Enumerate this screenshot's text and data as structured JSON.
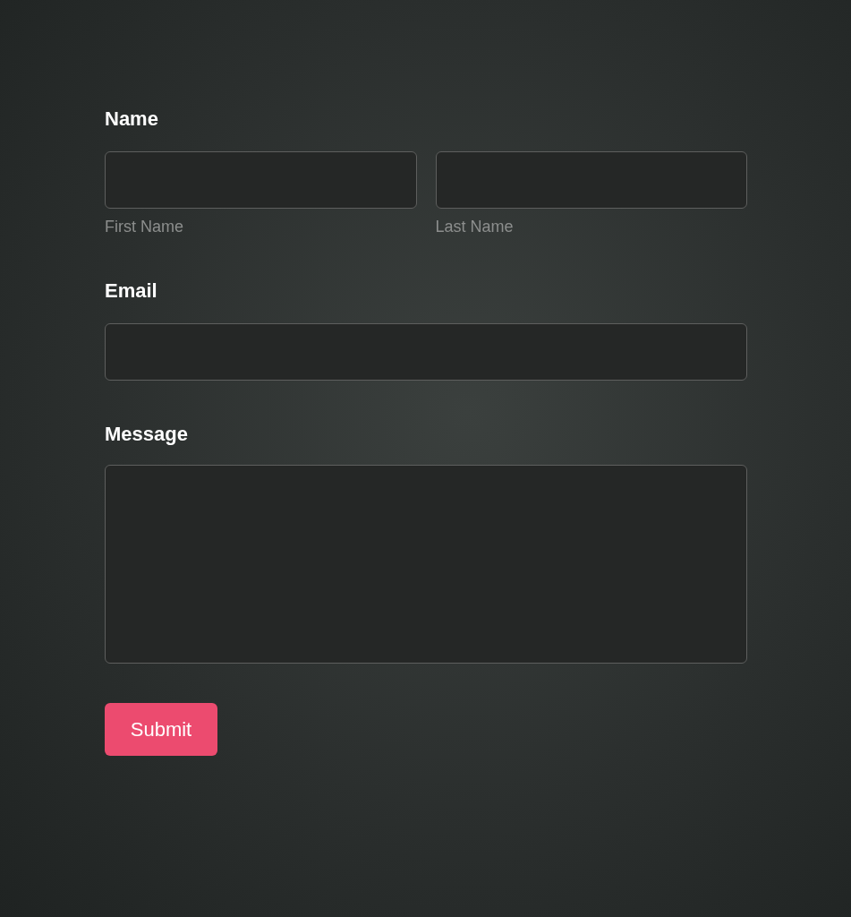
{
  "form": {
    "fields": [
      {
        "kind": "name",
        "label": "Name",
        "parts": [
          {
            "sublabel": "First Name"
          },
          {
            "sublabel": "Last Name"
          }
        ]
      },
      {
        "kind": "email",
        "label": "Email"
      },
      {
        "kind": "textarea",
        "label": "Message"
      }
    ],
    "submit": {
      "label": "Submit"
    }
  }
}
